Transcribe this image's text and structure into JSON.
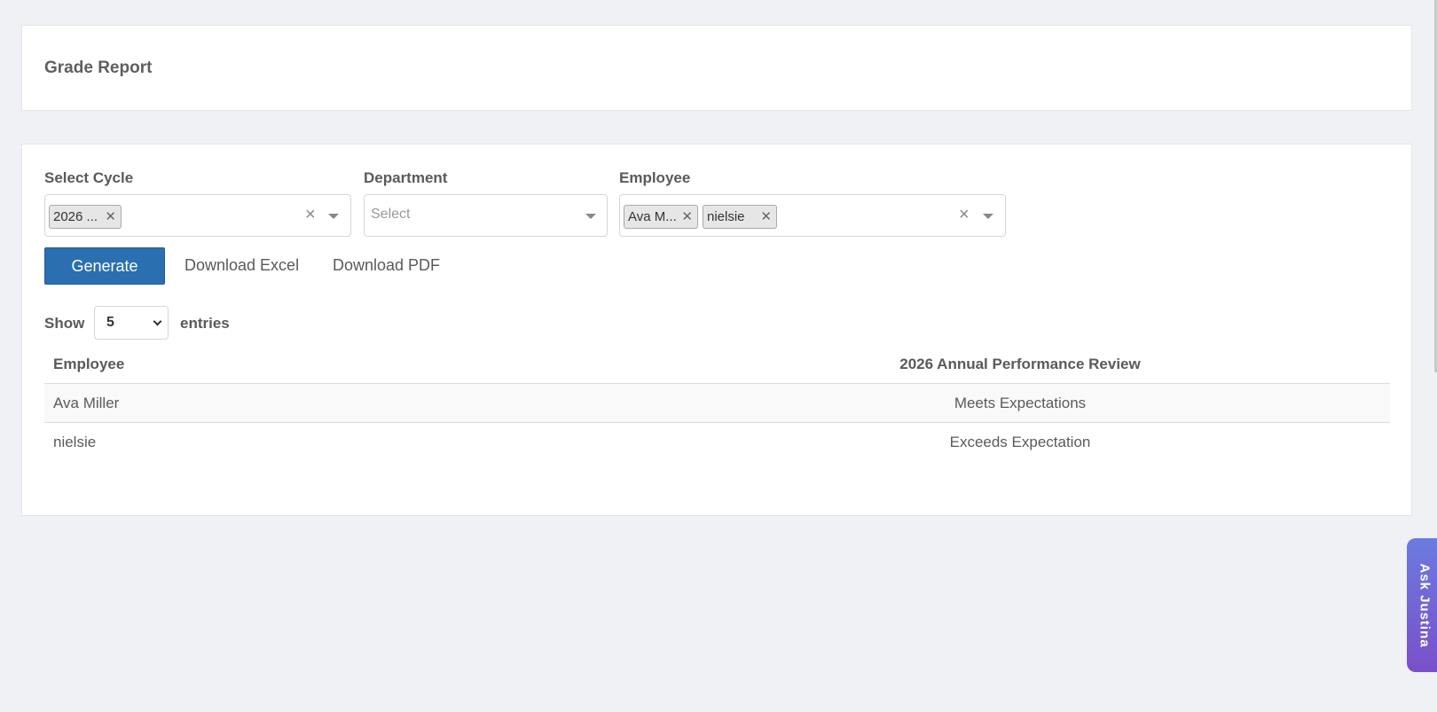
{
  "page": {
    "title": "Grade Report"
  },
  "filters": {
    "cycle": {
      "label": "Select Cycle",
      "chips": [
        "2026 ..."
      ]
    },
    "department": {
      "label": "Department",
      "placeholder": "Select"
    },
    "employee": {
      "label": "Employee",
      "chips": [
        "Ava M...",
        "nielsie"
      ]
    }
  },
  "actions": {
    "generate": "Generate",
    "download_excel": "Download Excel",
    "download_pdf": "Download PDF"
  },
  "entries": {
    "show_label": "Show",
    "value": "5",
    "entries_label": "entries"
  },
  "table": {
    "headers": [
      "Employee",
      "2026 Annual Performance Review"
    ],
    "rows": [
      [
        "Ava Miller",
        "Meets Expectations"
      ],
      [
        "nielsie",
        "Exceeds Expectation"
      ]
    ]
  },
  "assistant": {
    "label": "Ask Justina"
  },
  "colors": {
    "primary": "#2a6fb0",
    "assistant_gradient_start": "#6b7be0",
    "assistant_gradient_end": "#7b4fc9"
  }
}
